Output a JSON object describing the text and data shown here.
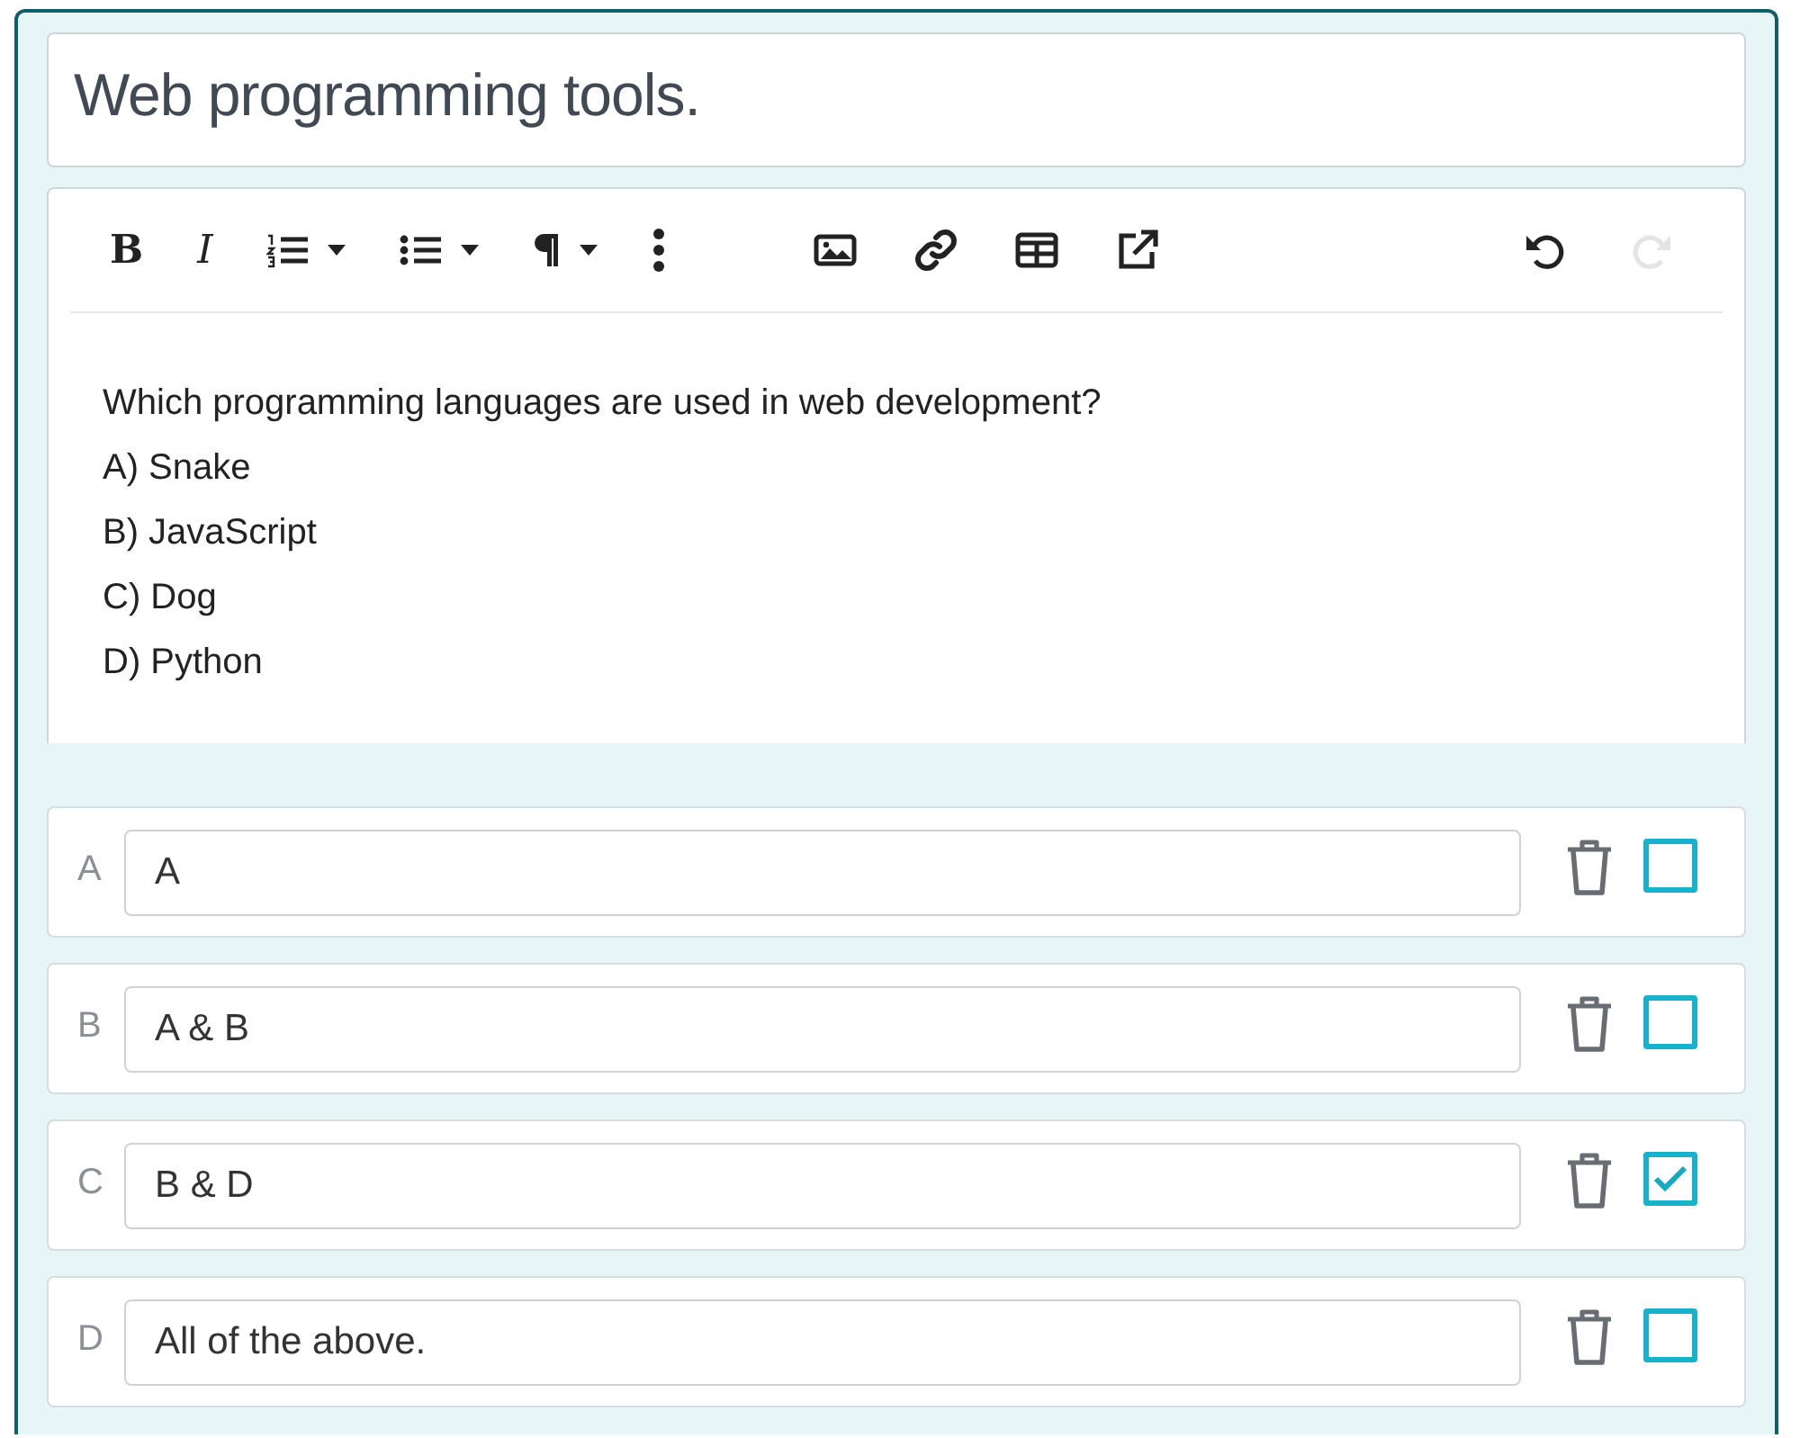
{
  "title": {
    "value": "Web programming tools."
  },
  "toolbar": {
    "groups": [
      [
        {
          "kind": "bold",
          "label": "B",
          "dropdown": false,
          "disabled": false
        },
        {
          "kind": "italic",
          "label": "I",
          "dropdown": false,
          "disabled": false
        },
        {
          "kind": "ordered-list",
          "dropdown": true,
          "disabled": false
        },
        {
          "kind": "bullet-list",
          "dropdown": true,
          "disabled": false
        },
        {
          "kind": "paragraph",
          "dropdown": true,
          "disabled": false
        },
        {
          "kind": "more",
          "dropdown": false,
          "disabled": false
        }
      ],
      [
        {
          "kind": "image",
          "dropdown": false,
          "disabled": false
        },
        {
          "kind": "link",
          "dropdown": false,
          "disabled": false
        },
        {
          "kind": "table",
          "dropdown": false,
          "disabled": false
        },
        {
          "kind": "external",
          "dropdown": false,
          "disabled": false
        }
      ],
      [
        {
          "kind": "undo",
          "dropdown": false,
          "disabled": false
        },
        {
          "kind": "redo",
          "dropdown": false,
          "disabled": true
        }
      ]
    ]
  },
  "content": [
    "Which programming languages are used in web development?",
    "A) Snake",
    "B) JavaScript",
    "C) Dog",
    "D) Python"
  ],
  "answers": [
    {
      "letter": "A",
      "value": "A",
      "checked": false
    },
    {
      "letter": "B",
      "value": "A & B",
      "checked": false
    },
    {
      "letter": "C",
      "value": "B & D",
      "checked": true
    },
    {
      "letter": "D",
      "value": "All of the above.",
      "checked": false
    }
  ]
}
